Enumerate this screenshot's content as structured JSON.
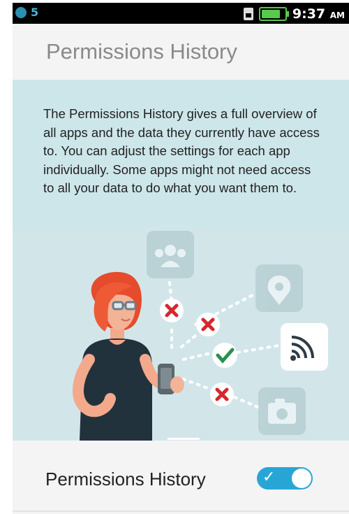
{
  "status_bar": {
    "notification_count": "5",
    "time": "9:37",
    "time_suffix": "AM",
    "icons": [
      "notification-icon",
      "sim-icon",
      "battery-icon"
    ]
  },
  "header": {
    "title": "Permissions History"
  },
  "description": {
    "text": "The Permissions History gives a full overview of all apps and the data they currently have access to. You can adjust the settings for each app individually. Some apps might not need access to all your data to do what you want them to."
  },
  "illustration": {
    "permission_icons": [
      "contacts-icon",
      "location-icon",
      "wifi-icon",
      "camera-icon"
    ],
    "status_marks": [
      "deny-icon",
      "deny-icon",
      "allow-icon",
      "deny-icon"
    ]
  },
  "setting": {
    "label": "Permissions History",
    "enabled": true
  },
  "colors": {
    "accent": "#27a6d6",
    "panel_bg": "#cde6ea",
    "deny": "#d7272d",
    "allow": "#2a8f4d"
  }
}
